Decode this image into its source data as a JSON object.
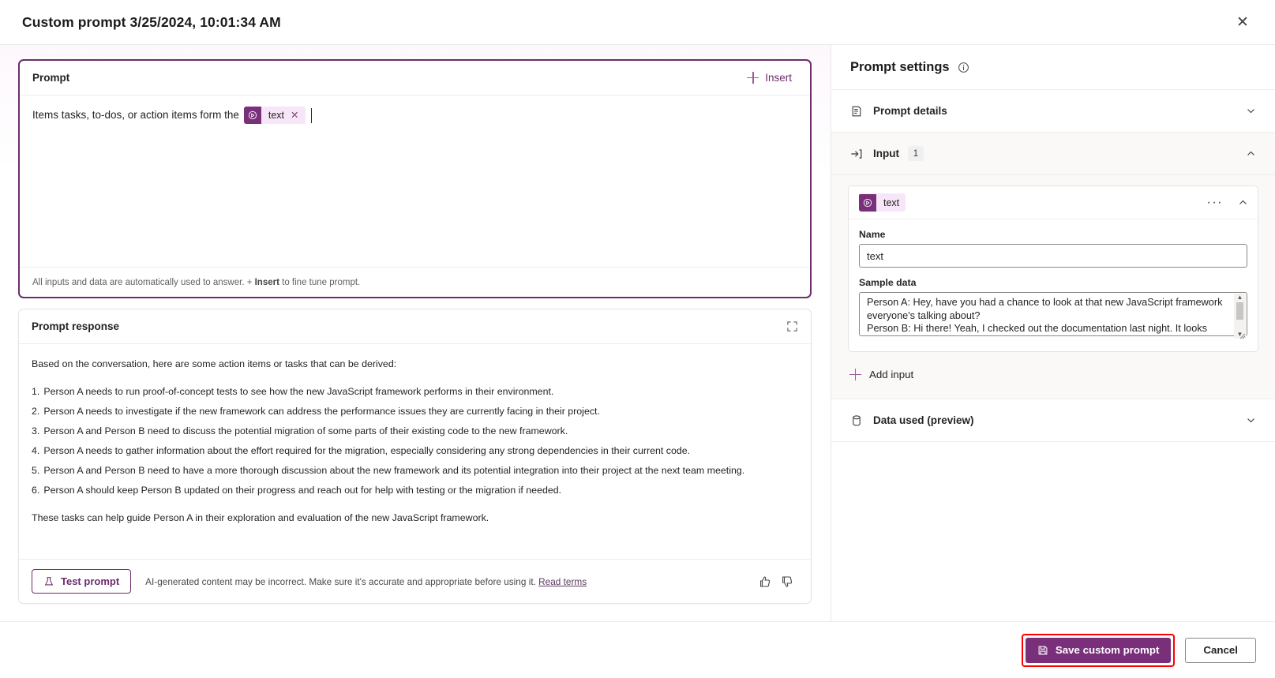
{
  "window": {
    "title": "Custom prompt 3/25/2024, 10:01:34 AM",
    "close_label": "✕"
  },
  "prompt_card": {
    "header_label": "Prompt",
    "insert_label": "Insert",
    "text_before_token": "Items tasks, to-dos, or action items form the",
    "token_label": "text",
    "token_remove_label": "✕",
    "footer_note_start": "All inputs and data are automatically used to answer. +",
    "footer_note_bold": "Insert",
    "footer_note_end": "to fine tune prompt."
  },
  "response_card": {
    "header_label": "Prompt response",
    "intro": "Based on the conversation, here are some action items or tasks that can be derived:",
    "items": [
      {
        "num": "1.",
        "text": "Person A needs to run proof-of-concept tests to see how the new JavaScript framework performs in their environment."
      },
      {
        "num": "2.",
        "text": "Person A needs to investigate if the new framework can address the performance issues they are currently facing in their project."
      },
      {
        "num": "3.",
        "text": "Person A and Person B need to discuss the potential migration of some parts of their existing code to the new framework."
      },
      {
        "num": "4.",
        "text": "Person A needs to gather information about the effort required for the migration, especially considering any strong dependencies in their current code."
      },
      {
        "num": "5.",
        "text": "Person A and Person B need to have a more thorough discussion about the new framework and its potential integration into their project at the next team meeting."
      },
      {
        "num": "6.",
        "text": "Person A should keep Person B updated on their progress and reach out for help with testing or the migration if needed."
      }
    ],
    "outro": "These tasks can help guide Person A in their exploration and evaluation of the new JavaScript framework.",
    "test_button_label": "Test prompt",
    "disclaimer_text": "AI-generated content may be incorrect. Make sure it's accurate and appropriate before using it.",
    "disclaimer_link": "Read terms"
  },
  "settings": {
    "title": "Prompt settings",
    "prompt_details_label": "Prompt details",
    "input_label": "Input",
    "input_count": "1",
    "data_used_label": "Data used (preview)",
    "add_input_label": "Add input",
    "input_card": {
      "token_label": "text",
      "overflow_label": "···",
      "name_field_label": "Name",
      "name_field_value": "text",
      "sample_field_label": "Sample data",
      "sample_field_value": "Person A: Hey, have you had a chance to look at that new JavaScript framework everyone's talking about?\nPerson B: Hi there! Yeah, I checked out the documentation last night. It looks impressive. Before we commit, we should check the"
    }
  },
  "footer": {
    "save_label": "Save custom prompt",
    "cancel_label": "Cancel"
  },
  "colors": {
    "brand_purple": "#7a2f7a",
    "prompt_border": "#6b2d6b",
    "highlight_red": "#ff0000",
    "token_bg": "#f7e6f7"
  }
}
